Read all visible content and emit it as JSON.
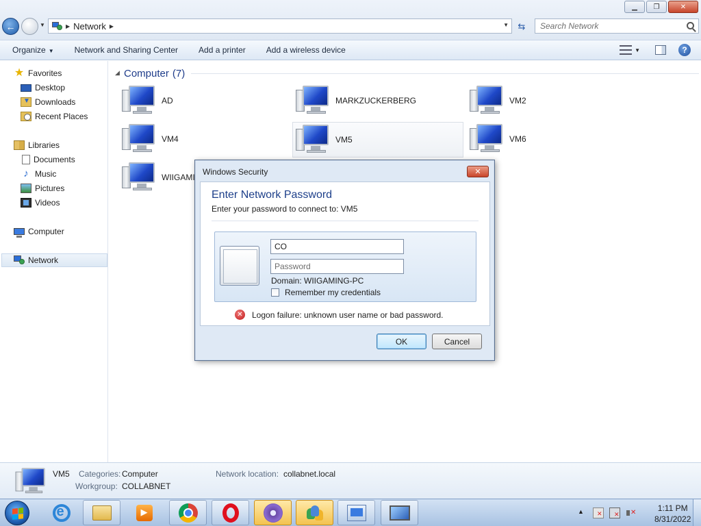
{
  "window": {
    "minimize": "▁",
    "maximize": "❐",
    "close": "✕"
  },
  "address": {
    "location": "Network",
    "search_placeholder": "Search Network"
  },
  "toolbar": {
    "organize": "Organize",
    "items": [
      "Network and Sharing Center",
      "Add a printer",
      "Add a wireless device"
    ]
  },
  "nav": {
    "favorites": "Favorites",
    "desktop": "Desktop",
    "downloads": "Downloads",
    "recent": "Recent Places",
    "libraries": "Libraries",
    "documents": "Documents",
    "music": "Music",
    "pictures": "Pictures",
    "videos": "Videos",
    "computer": "Computer",
    "network": "Network"
  },
  "content": {
    "group_name": "Computer",
    "group_count": "(7)",
    "computers": [
      "AD",
      "MARKZUCKERBERG",
      "VM2",
      "VM4",
      "VM5",
      "VM6",
      "WIIGAMIN"
    ]
  },
  "details": {
    "name": "VM5",
    "categories_label": "Categories:",
    "categories_value": "Computer",
    "workgroup_label": "Workgroup:",
    "workgroup_value": "COLLABNET",
    "location_label": "Network location:",
    "location_value": "collabnet.local"
  },
  "dialog": {
    "title": "Windows Security",
    "heading": "Enter Network Password",
    "subtitle": "Enter your password to connect to: VM5",
    "username_value": "CO",
    "password_placeholder": "Password",
    "domain": "Domain: WIIGAMING-PC",
    "remember": "Remember my credentials",
    "error": "Logon failure: unknown user name or bad password.",
    "ok": "OK",
    "cancel": "Cancel"
  },
  "clock": {
    "time": "1:11 PM",
    "date": "8/31/2022"
  },
  "icons": {
    "start": "windows-start-orb",
    "taskbar": [
      "ie-icon",
      "explorer-folder-icon",
      "media-player-icon",
      "chrome-icon",
      "opera-icon",
      "bittorrent-icon",
      "people-icon",
      "network-center-icon",
      "display-icon"
    ]
  }
}
